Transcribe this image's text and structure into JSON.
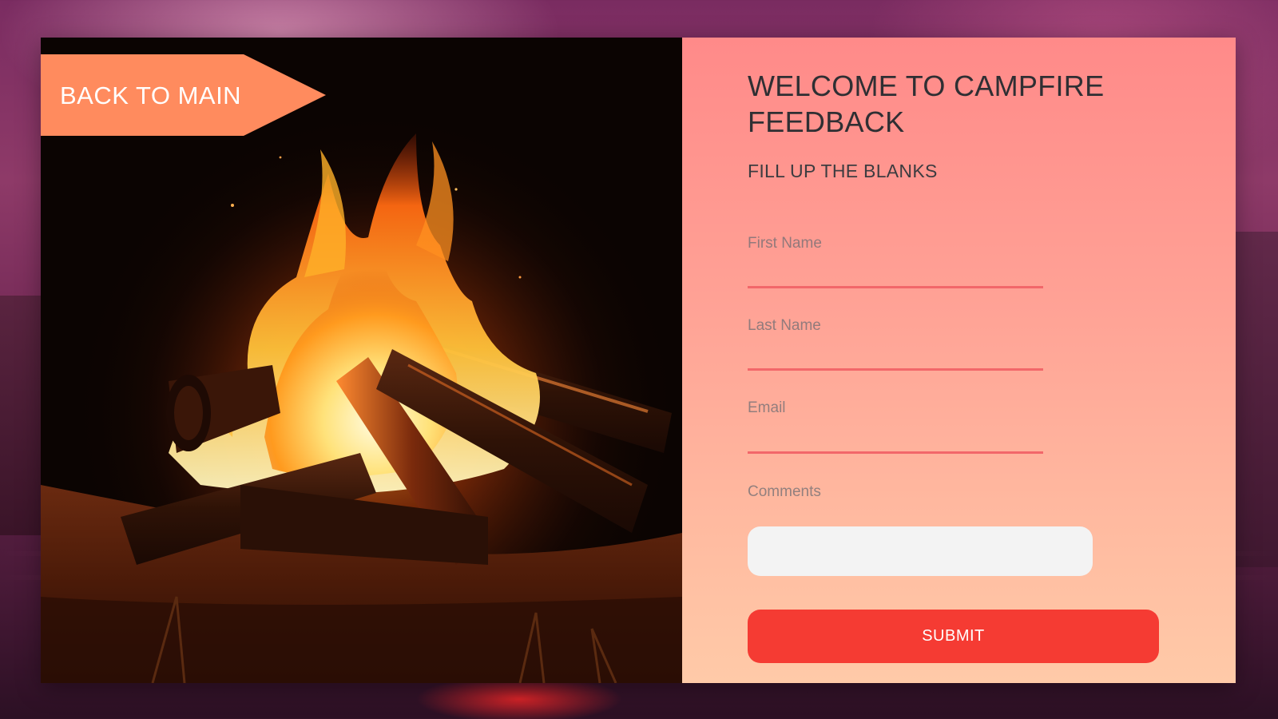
{
  "back_button": {
    "label": "BACK TO MAIN"
  },
  "form": {
    "title": "WELCOME TO CAMPFIRE FEEDBACK",
    "subtitle": "FILL UP THE BLANKS",
    "fields": [
      {
        "label": "First Name",
        "value": ""
      },
      {
        "label": "Last Name",
        "value": ""
      },
      {
        "label": "Email",
        "value": ""
      },
      {
        "label": "Comments",
        "value": ""
      }
    ],
    "submit_label": "SUBMIT"
  },
  "colors": {
    "accent_orange": "#ff8b5e",
    "submit_red": "#f53b33",
    "underline_red": "#f2676a",
    "panel_gradient_top": "#ff8a89",
    "panel_gradient_bottom": "#ffcaa8"
  },
  "hero_image": {
    "subject": "campfire-photo"
  }
}
